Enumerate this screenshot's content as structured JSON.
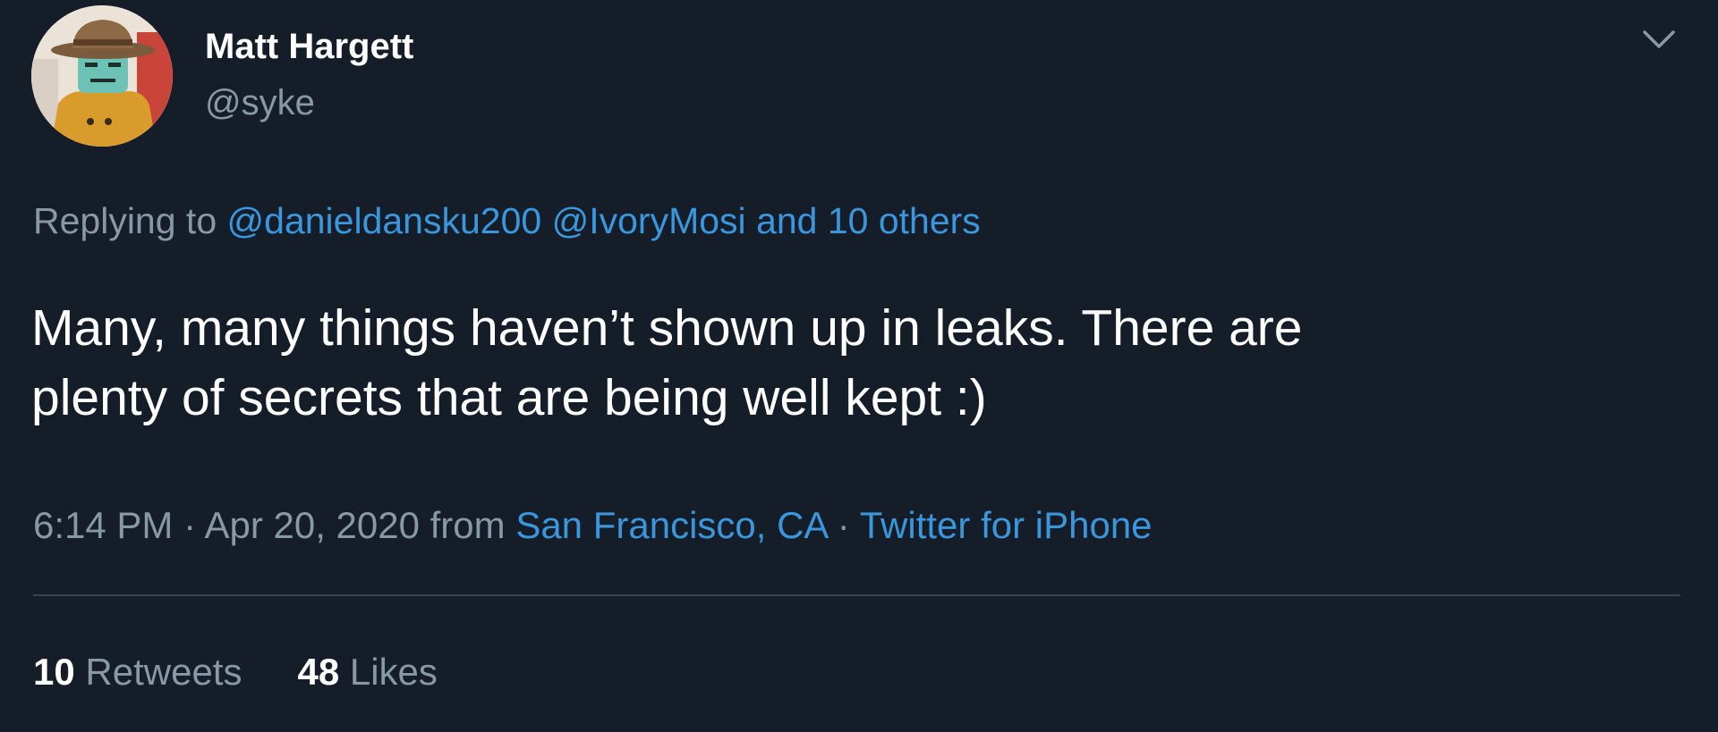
{
  "author": {
    "display_name": "Matt Hargett",
    "handle": "@syke",
    "avatar_icon": "avatar-detective-figure"
  },
  "menu": {
    "icon": "chevron-down-icon"
  },
  "reply": {
    "prefix": "Replying to",
    "mention_1": "@danieldansku200",
    "mention_2": "@IvoryMosi",
    "others": "and 10 others"
  },
  "tweet": {
    "line_1": "Many, many things haven’t shown up in leaks. There are",
    "line_2": "plenty of secrets that are being well kept :)"
  },
  "meta": {
    "time": "6:14 PM",
    "sep_1": "·",
    "date": "Apr 20, 2020",
    "from": "from",
    "location": "San Francisco, CA",
    "sep_2": "·",
    "client": "Twitter for iPhone"
  },
  "stats": {
    "retweets_count": "10",
    "retweets_label": "Retweets",
    "likes_count": "48",
    "likes_label": "Likes"
  },
  "colors": {
    "background": "#151d28",
    "text": "#ffffff",
    "muted": "#8899a6",
    "link": "#3a96dd",
    "divider": "#38444d"
  }
}
